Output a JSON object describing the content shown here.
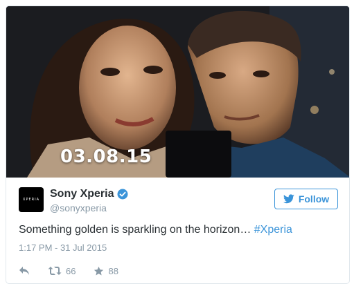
{
  "photo": {
    "date_overlay": "03.08.15"
  },
  "author": {
    "avatar_text": "XPERIA",
    "display_name": "Sony Xperia",
    "handle": "@sonyxperia",
    "verified": true
  },
  "follow_button": {
    "label": "Follow",
    "icon": "twitter-bird-icon"
  },
  "tweet": {
    "text": "Something golden is sparkling on the horizon… ",
    "hashtag": "#Xperia",
    "timestamp": "1:17 PM - 31 Jul 2015"
  },
  "actions": {
    "reply": {
      "icon": "reply-icon"
    },
    "retweet": {
      "icon": "retweet-icon",
      "count": "66"
    },
    "favorite": {
      "icon": "star-icon",
      "count": "88"
    }
  },
  "colors": {
    "link": "#3b94d9",
    "text": "#292f33",
    "muted": "#8899a6",
    "border": "#e1e8ed"
  }
}
